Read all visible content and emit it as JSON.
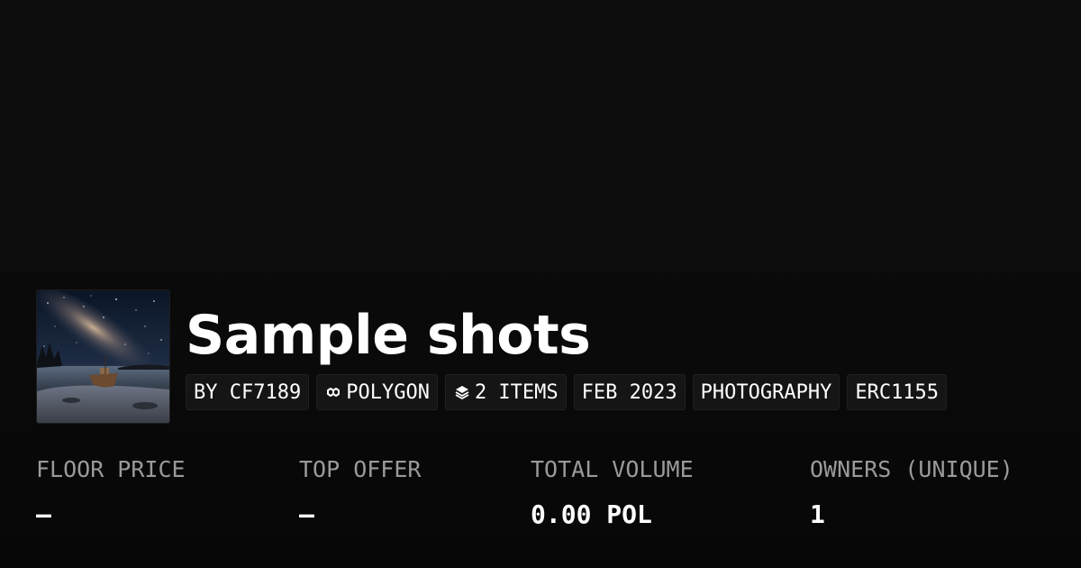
{
  "collection": {
    "title": "Sample shots"
  },
  "tags": {
    "creator": "BY CF7189",
    "chain": "POLYGON",
    "items": "2 ITEMS",
    "date": "FEB 2023",
    "category": "PHOTOGRAPHY",
    "standard": "ERC1155"
  },
  "icons": {
    "chain": "polygon-link-icon",
    "items": "layers-icon"
  },
  "stats": {
    "floor_price": {
      "label": "FLOOR PRICE",
      "value": "–"
    },
    "top_offer": {
      "label": "TOP OFFER",
      "value": "–"
    },
    "total_volume": {
      "label": "TOTAL VOLUME",
      "value": "0.00 POL"
    },
    "owners": {
      "label": "OWNERS (UNIQUE)",
      "value": "1"
    }
  },
  "colors": {
    "background": "#0a0a0a",
    "tag_background": "#151515",
    "label_gray": "#9a9a9a",
    "text": "#ffffff"
  }
}
